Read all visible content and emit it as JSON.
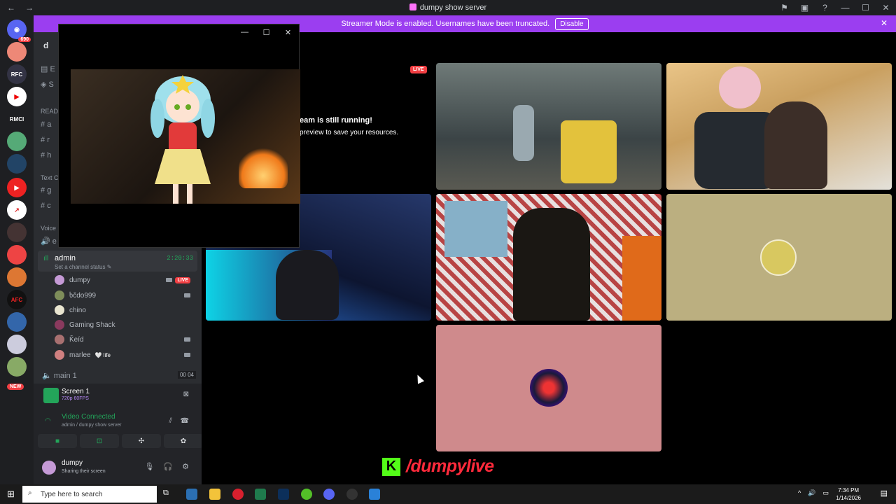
{
  "window": {
    "title": "dumpy show server",
    "nav_back": "←",
    "nav_forward": "→",
    "controls": [
      "—",
      "☐",
      "✕"
    ]
  },
  "streamer_banner": {
    "text": "Streamer Mode is enabled. Usernames have been truncated.",
    "button": "Disable",
    "close": "✕"
  },
  "servers": {
    "discord_badge": "690",
    "labels": [
      "RFC",
      "RMCI",
      "AFC"
    ],
    "new_badge": "NEW"
  },
  "sidebar": {
    "server_name": "d",
    "readme_category": "READ",
    "text_category": "Text C",
    "voice_category": "Voice",
    "items": [
      {
        "icon": "▤",
        "label": "E"
      },
      {
        "icon": "◈",
        "label": "S"
      },
      {
        "icon": "#",
        "label": "a"
      },
      {
        "icon": "#",
        "label": "r"
      },
      {
        "icon": "#",
        "label": "h"
      },
      {
        "icon": "#",
        "label": "g"
      },
      {
        "icon": "#",
        "label": "c"
      },
      {
        "icon": "🔊",
        "label": "e"
      }
    ],
    "voice_channel": {
      "name": "admin",
      "status": "Set a channel status ✎",
      "timer": "2:20:33"
    },
    "users": [
      {
        "name": "dumpy",
        "live": "LIVE",
        "cam": true,
        "color": "#c59ad6"
      },
      {
        "name": "ხčdo999",
        "live": "",
        "cam": true,
        "color": "#7e8d5a"
      },
      {
        "name": "chino",
        "live": "",
        "cam": false,
        "color": "#e9e5d0"
      },
      {
        "name": "Gaming Shack",
        "live": "",
        "cam": false,
        "color": "#8a3a5e"
      },
      {
        "name": "Ǩeíd",
        "live": "",
        "cam": true,
        "color": "#a87070"
      },
      {
        "name": "marlee",
        "live": "",
        "cam": true,
        "color": "#d08080"
      }
    ],
    "marlee_badge": "🤍 life",
    "main_channel": {
      "name": "main 1",
      "count_a": "00",
      "count_b": "04"
    }
  },
  "panel": {
    "screen_title": "Screen 1",
    "screen_quality": "720p 60FPS",
    "connection_status": "Video Connected",
    "connection_detail": "admin / dumpy show server",
    "user_name": "dumpy",
    "user_status": "Sharing their screen"
  },
  "stage": {
    "live_tag": "LIVE",
    "paused_title": "eam is still running!",
    "paused_text": "preview to save your resources."
  },
  "branding": {
    "k_logo": "K",
    "handle": "/dumpylive"
  },
  "taskbar": {
    "search_placeholder": "Type here to search",
    "time": "7:34 PM",
    "date": "1/14/2026"
  }
}
